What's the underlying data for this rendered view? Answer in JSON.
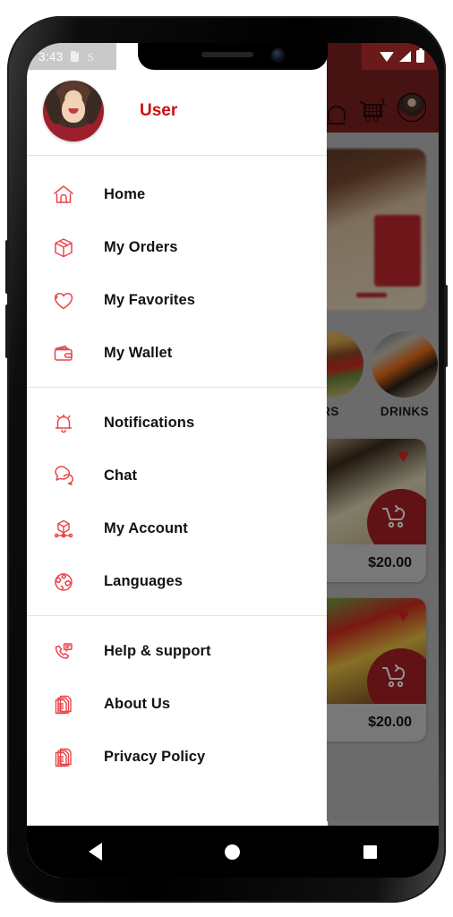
{
  "status_bar": {
    "time": "3:43",
    "left_icons": [
      "sd-card-icon",
      "sim-icon"
    ],
    "right_icons": [
      "wifi-icon",
      "signal-icon",
      "battery-icon"
    ]
  },
  "drawer": {
    "header": {
      "username": "User",
      "avatar": "user-avatar"
    },
    "groups": [
      {
        "items": [
          {
            "icon": "home-icon",
            "label": "Home"
          },
          {
            "icon": "box-icon",
            "label": "My Orders"
          },
          {
            "icon": "heart-icon",
            "label": "My Favorites"
          },
          {
            "icon": "wallet-icon",
            "label": "My Wallet"
          }
        ]
      },
      {
        "items": [
          {
            "icon": "bell-icon",
            "label": "Notifications"
          },
          {
            "icon": "chat-bubble-icon",
            "label": "Chat"
          },
          {
            "icon": "account-node-icon",
            "label": "My Account"
          },
          {
            "icon": "globe-icon",
            "label": "Languages"
          }
        ]
      },
      {
        "items": [
          {
            "icon": "phone-support-icon",
            "label": "Help & support"
          },
          {
            "icon": "documents-icon",
            "label": "About Us"
          },
          {
            "icon": "documents-icon",
            "label": "Privacy Policy"
          }
        ]
      }
    ]
  },
  "background_app": {
    "app_bar": {
      "bell_icon": "bell-icon",
      "cart_icon": "cart-icon",
      "cart_badge": "1",
      "avatar": "profile-avatar"
    },
    "categories": [
      {
        "label": "RS",
        "image": "burger-category"
      },
      {
        "label": "DRINKS",
        "image": "drinks-category"
      }
    ],
    "food_cards": [
      {
        "price": "$20.00",
        "image": "pizza",
        "favorite": true,
        "cart_icon": "add-to-cart-icon"
      },
      {
        "price": "$20.00",
        "image": "burger",
        "favorite": true,
        "cart_icon": "add-to-cart-icon"
      }
    ],
    "trailing_heart": "♡"
  },
  "nav_bar": {
    "back": "back-button",
    "home": "home-button",
    "recents": "recents-button"
  },
  "colors": {
    "brand_red": "#cc1111",
    "icon_red": "#e8454a",
    "app_bar_red": "#7a1f1f",
    "fab_red": "#a81f25"
  }
}
